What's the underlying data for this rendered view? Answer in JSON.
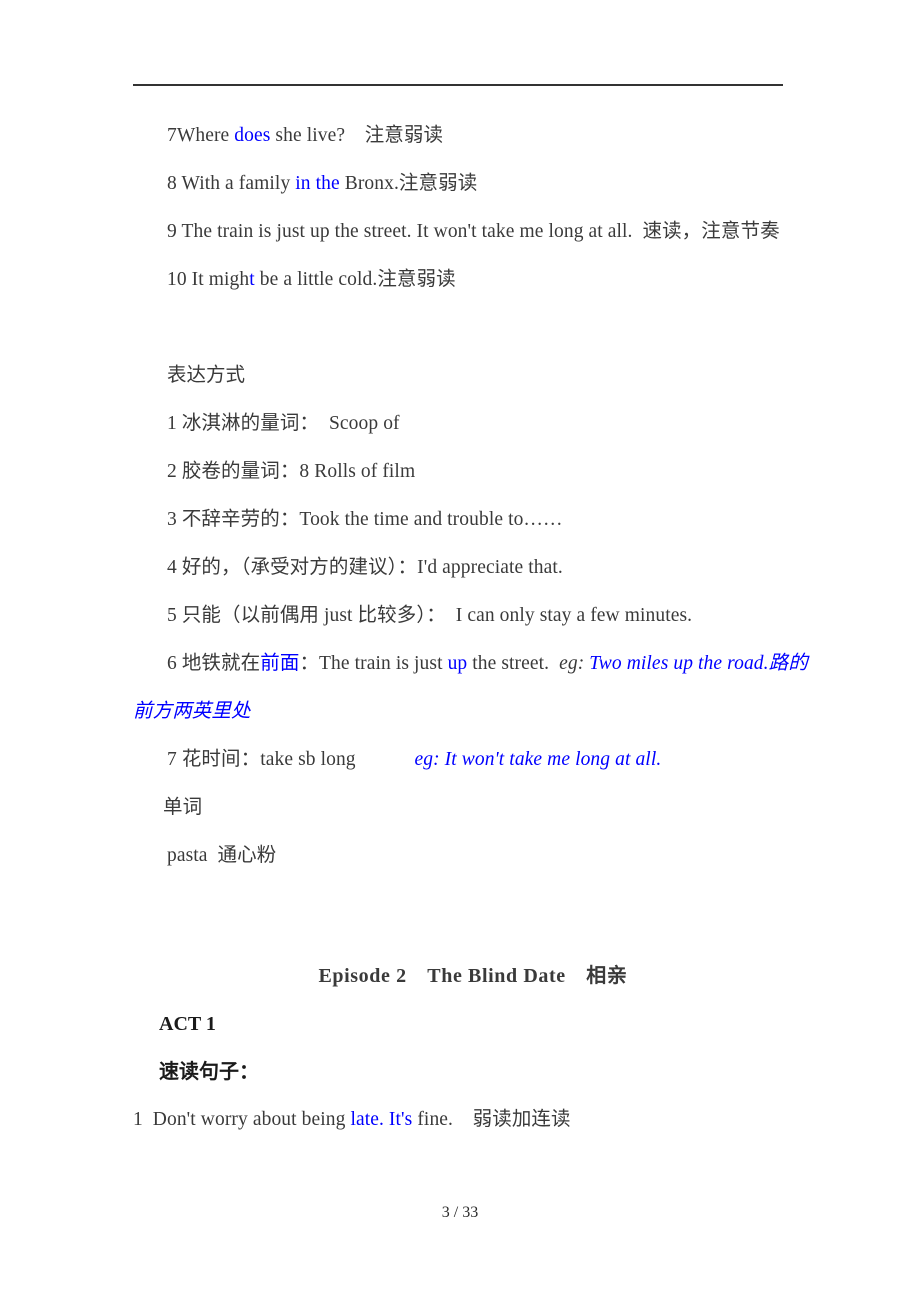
{
  "document": {
    "footer": "3 / 33",
    "colors": {
      "text": "#3a3a3a",
      "highlight_blue": "#0000ff",
      "rule": "#333333"
    }
  },
  "pronunciation_section": {
    "items": [
      {
        "number": "7",
        "parts": [
          {
            "text": "7Where ",
            "style": "plain"
          },
          {
            "text": "does",
            "style": "blue"
          },
          {
            "text": " she live?　注意弱读",
            "style": "plain"
          }
        ],
        "plain_text": "7Where does she live?　注意弱读"
      },
      {
        "number": "8",
        "parts": [
          {
            "text": "8 With a family ",
            "style": "plain"
          },
          {
            "text": "in the",
            "style": "blue"
          },
          {
            "text": " Bronx.注意弱读",
            "style": "plain"
          }
        ],
        "plain_text": "8 With a family in the Bronx.注意弱读"
      },
      {
        "number": "9",
        "parts": [
          {
            "text": "9 The train is just up the street. It won't take me long at all.  速读，注意节奏",
            "style": "plain"
          }
        ],
        "plain_text": "9 The train is just up the street. It won't take me long at all.  速读，注意节奏"
      },
      {
        "number": "10",
        "parts": [
          {
            "text": "10 It migh",
            "style": "plain"
          },
          {
            "text": "t",
            "style": "blue"
          },
          {
            "text": " be a little cold.注意弱读",
            "style": "plain"
          }
        ],
        "plain_text": "10 It might be a little cold.注意弱读"
      }
    ]
  },
  "expression_section": {
    "heading": "表达方式",
    "items": [
      {
        "number": "1",
        "parts": [
          {
            "text": "1 冰淇淋的量词：  Scoop of",
            "style": "plain"
          }
        ]
      },
      {
        "number": "2",
        "parts": [
          {
            "text": "2 胶卷的量词：8 Rolls of film",
            "style": "plain"
          }
        ]
      },
      {
        "number": "3",
        "parts": [
          {
            "text": "3 不辞辛劳的：Took the time and trouble to……",
            "style": "plain"
          }
        ]
      },
      {
        "number": "4",
        "parts": [
          {
            "text": "4 好的，（承受对方的建议）：I'd appreciate that.",
            "style": "plain"
          }
        ]
      },
      {
        "number": "5",
        "parts": [
          {
            "text": "5 只能（以前偶用 just 比较多）：  I can only stay a few minutes.",
            "style": "plain"
          }
        ]
      },
      {
        "number": "6",
        "parts": [
          {
            "text": "6 地铁就在",
            "style": "plain"
          },
          {
            "text": "前面",
            "style": "blue"
          },
          {
            "text": "：The train is just ",
            "style": "plain"
          },
          {
            "text": "up",
            "style": "blue"
          },
          {
            "text": " the street.  ",
            "style": "plain"
          },
          {
            "text": "eg:",
            "style": "italic"
          },
          {
            "text": " Two miles up the road.路的前方两英里处",
            "style": "blue-italic"
          }
        ]
      },
      {
        "number": "7",
        "parts": [
          {
            "text": "7 花时间：take sb long",
            "style": "plain"
          },
          {
            "text": "　　　eg: It won't take me long at all.",
            "style": "blue-italic"
          }
        ]
      }
    ]
  },
  "vocabulary_section": {
    "heading": "单词",
    "entries": [
      {
        "word": "pasta",
        "meaning": "通心粉",
        "line": "pasta  通心粉"
      }
    ]
  },
  "episode": {
    "title": "Episode 2　The Blind Date　相亲",
    "act": "ACT 1",
    "subheading": "速读句子：",
    "sentences": [
      {
        "number": "1",
        "parts": [
          {
            "text": "1  Don't worry about being ",
            "style": "plain"
          },
          {
            "text": "late. It's",
            "style": "blue"
          },
          {
            "text": " fine.　弱读加连读",
            "style": "plain"
          }
        ],
        "plain_text": "1  Don't worry about being late. It's fine.　弱读加连读"
      }
    ]
  }
}
